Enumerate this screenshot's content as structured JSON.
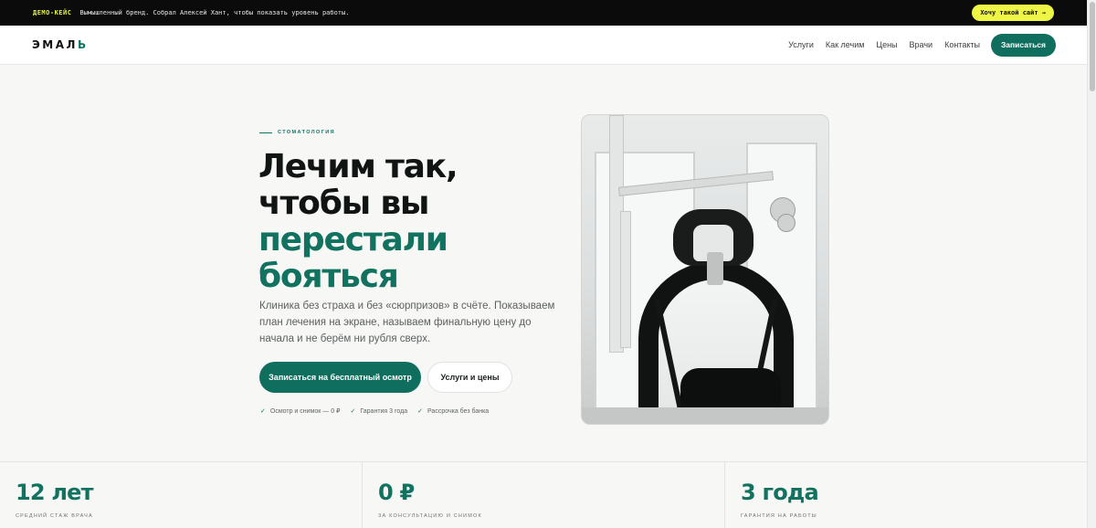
{
  "demo_bar": {
    "tag": "ДЕМО-КЕЙС",
    "text": "Вымышленный бренд. Собрал Алексей Хант, чтобы показать уровень работы.",
    "cta": "Хочу такой сайт →"
  },
  "header": {
    "logo_main": "ЭМАЛ",
    "logo_accent": "Ь",
    "nav": [
      "Услуги",
      "Как лечим",
      "Цены",
      "Врачи",
      "Контакты"
    ],
    "cta": "Записаться"
  },
  "hero": {
    "eyebrow": "СТОМАТОЛОГИЯ",
    "title_dark_1": "Лечим так,",
    "title_dark_2": "чтобы вы",
    "title_green_1": "перестали",
    "title_green_2": "бояться",
    "lead": "Клиника без страха и без «сюрпризов» в счёте. Показываем план лечения на экране, называем финальную цену до начала и не берём ни рубля сверх.",
    "primary_button": "Записаться на бесплатный осмотр",
    "secondary_button": "Услуги и цены",
    "bullets": [
      "Осмотр и снимок — 0 ₽",
      "Гарантия 3 года",
      "Рассрочка без банка"
    ],
    "check_glyph": "✓"
  },
  "stats": [
    {
      "value": "12 лет",
      "label": "СРЕДНИЙ СТАЖ ВРАЧА"
    },
    {
      "value": "0 ₽",
      "label": "ЗА КОНСУЛЬТАЦИЮ И СНИМОК"
    },
    {
      "value": "3 года",
      "label": "ГАРАНТИЯ НА РАБОТЫ"
    }
  ],
  "colors": {
    "brand_green": "#11735f",
    "demo_yellow": "#eef544",
    "demo_bg": "#0b0b0b"
  },
  "icons": {
    "check": "check-icon",
    "photo": "dental-chair-photo"
  }
}
